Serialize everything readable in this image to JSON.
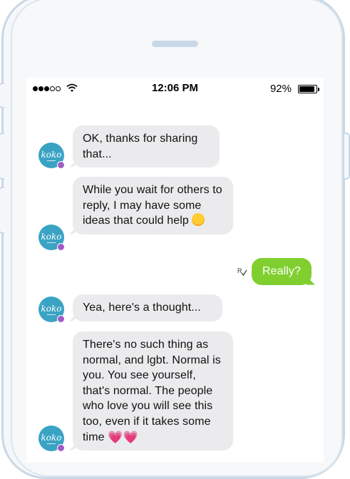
{
  "status_bar": {
    "time": "12:06 PM",
    "battery_percent": "92%",
    "battery_level": 0.92,
    "signal_bars_filled": 3,
    "signal_bars_total": 5
  },
  "bot": {
    "avatar_text": "koko"
  },
  "messages": [
    {
      "from": "bot",
      "text": "OK, thanks for sharing that..."
    },
    {
      "from": "bot",
      "text": "While you wait for others to reply, I may have some ideas that could help",
      "emoji": "smile-emoji"
    },
    {
      "from": "user",
      "text": "Really?"
    },
    {
      "from": "bot",
      "text": "Yea, here's a thought..."
    },
    {
      "from": "bot",
      "text": "There's no such thing as normal, and lgbt. Normal is you. You see yourself, that's normal. The people who love you will see this too, even if it takes some time",
      "emoji": "hearts-emoji"
    }
  ],
  "colors": {
    "bot_bubble": "#ebebed",
    "user_bubble": "#80cf2f",
    "avatar": "#3aa3c4",
    "avatar_badge": "#a05cc9",
    "phone_frame": "#c9d8e6"
  }
}
